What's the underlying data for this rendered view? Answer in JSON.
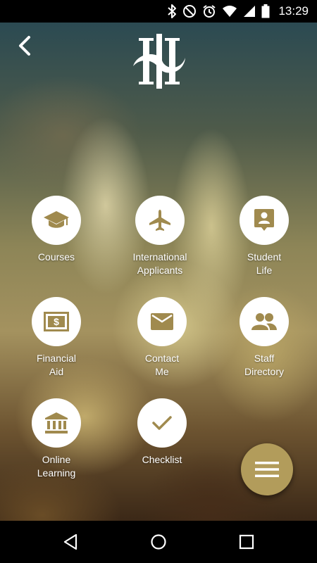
{
  "status_bar": {
    "time": "13:29",
    "icons": [
      "bluetooth-icon",
      "do-not-disturb-icon",
      "alarm-icon",
      "wifi-icon",
      "signal-icon",
      "battery-icon"
    ]
  },
  "header": {
    "back_icon": "chevron-left-icon",
    "logo": "institution-monogram-logo"
  },
  "menu": {
    "items": [
      {
        "label": "Courses",
        "icon": "graduation-cap-icon"
      },
      {
        "label": "International\nApplicants",
        "icon": "airplane-icon"
      },
      {
        "label": "Student\nLife",
        "icon": "person-badge-icon"
      },
      {
        "label": "Financial\nAid",
        "icon": "dollar-bill-icon"
      },
      {
        "label": "Contact\nMe",
        "icon": "envelope-icon"
      },
      {
        "label": "Staff\nDirectory",
        "icon": "people-icon"
      },
      {
        "label": "Online\nLearning",
        "icon": "bank-icon"
      },
      {
        "label": "Checklist",
        "icon": "checkmark-icon"
      }
    ]
  },
  "fab": {
    "icon": "hamburger-menu-icon"
  },
  "nav_bar": {
    "icons": [
      "back-triangle-icon",
      "home-circle-icon",
      "recents-square-icon"
    ]
  },
  "colors": {
    "accent_gold": "#b29c5b",
    "icon_gold": "#a08a4e",
    "circle_white": "#ffffff",
    "status_bar": "#000000"
  }
}
